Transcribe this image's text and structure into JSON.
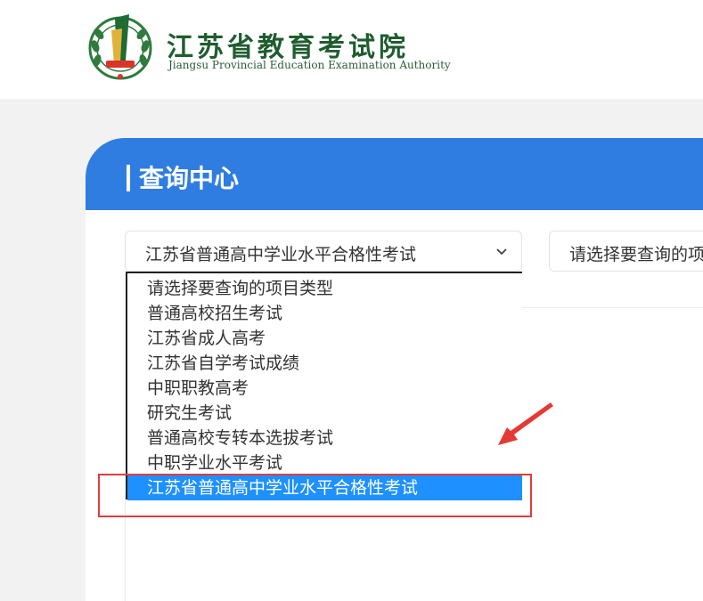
{
  "header": {
    "org_name_cn": "江苏省教育考试院",
    "org_name_en": "Jiangsu Provincial Education Examination Authority"
  },
  "panel": {
    "title": "查询中心"
  },
  "exam_select": {
    "selected_value": "江苏省普通高中学业水平合格性考试",
    "options": [
      "请选择要查询的项目类型",
      "普通高校招生考试",
      "江苏省成人高考",
      "江苏省自学考试成绩",
      "中职职教高考",
      "研究生考试",
      "普通高校专转本选拔考试",
      "中职学业水平考试",
      "江苏省普通高中学业水平合格性考试"
    ],
    "highlighted_index": 8
  },
  "second_select": {
    "value": "请选择要查询的项"
  },
  "colors": {
    "header_blue": "#2f7de1",
    "highlight_blue": "#1e90ff",
    "logo_green": "#1f5d2f",
    "annotation_red": "#e23c3c"
  },
  "icons": {
    "logo": "emblem-logo-icon",
    "dropdown": "chevron-down-icon",
    "annotation": "red-arrow-icon"
  }
}
